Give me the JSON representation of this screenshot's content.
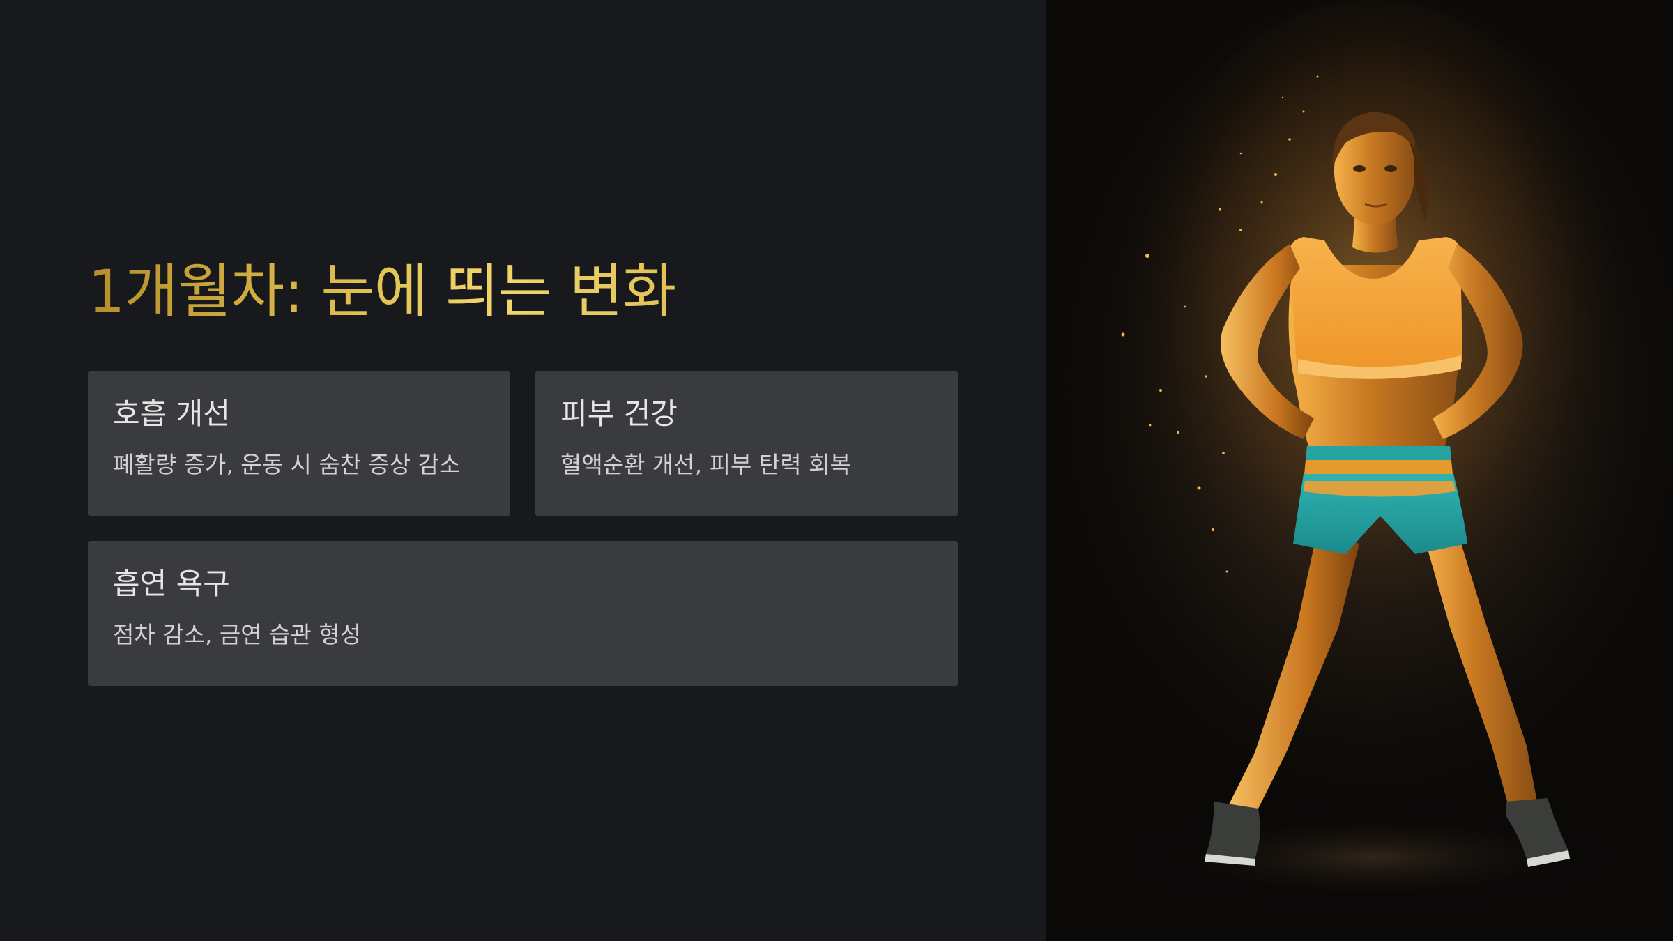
{
  "slide": {
    "title": "1개월차: 눈에 띄는 변화"
  },
  "cards": [
    {
      "title": "호흡 개선",
      "description": "폐활량 증가, 운동 시 숨찬 증상 감소"
    },
    {
      "title": "피부 건강",
      "description": "혈액순환 개선, 피부 탄력 회복"
    },
    {
      "title": "흡연 욕구",
      "description": "점차 감소, 금연 습관 형성"
    }
  ],
  "image": {
    "subject": "fitness-woman-illustration",
    "colors": {
      "glow": "#f2a33a",
      "top": "#f4a43b",
      "shorts": "#2aa7a8",
      "waistband": "#e59a2c",
      "background": "#1a140e"
    }
  }
}
